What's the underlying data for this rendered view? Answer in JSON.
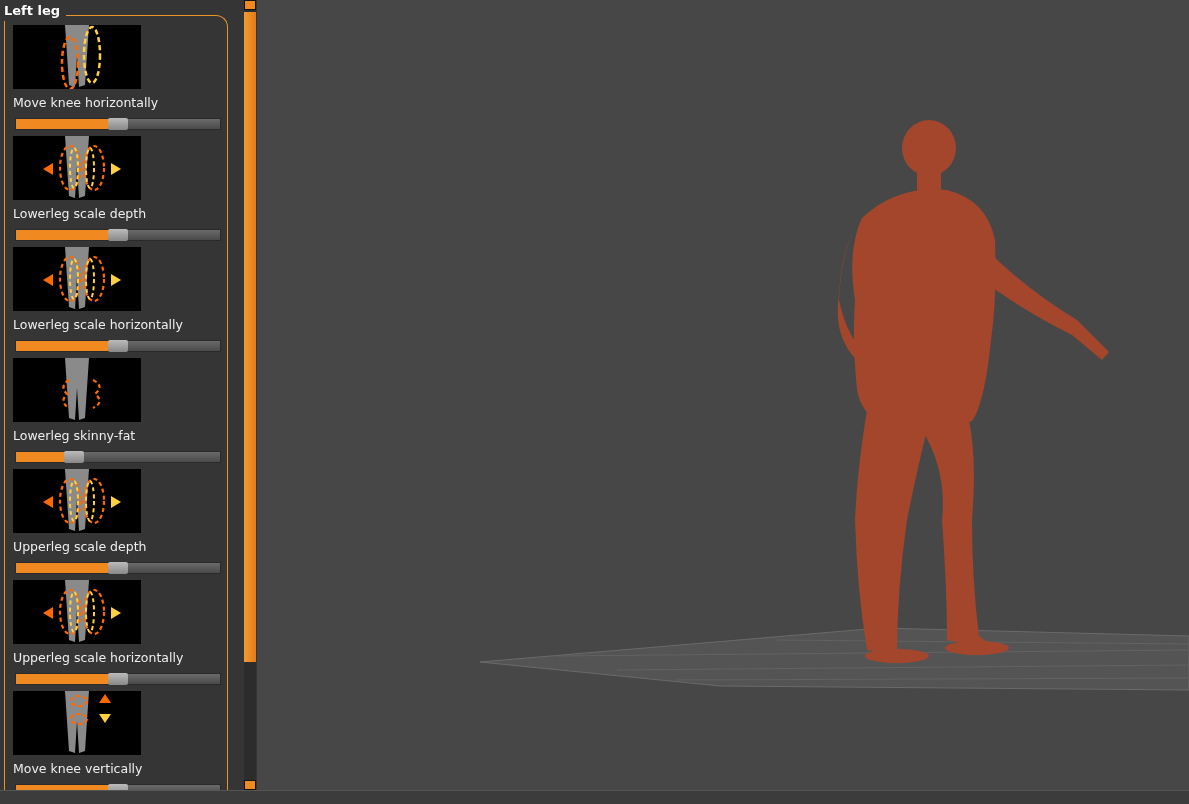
{
  "panel": {
    "title": "Left leg",
    "items": [
      {
        "label": "Move knee horizontally",
        "kind": "ellipse",
        "level": 0.5
      },
      {
        "label": "Lowerleg scale depth",
        "kind": "arrows-lr",
        "level": 0.5
      },
      {
        "label": "Lowerleg scale horizontally",
        "kind": "arrows-lr",
        "level": 0.5
      },
      {
        "label": "Lowerleg skinny-fat",
        "kind": "shape",
        "level": 0.26
      },
      {
        "label": "Upperleg scale depth",
        "kind": "arrows-lr",
        "level": 0.5
      },
      {
        "label": "Upperleg scale horizontally",
        "kind": "arrows-lr",
        "level": 0.5
      },
      {
        "label": "Move knee vertically",
        "kind": "arrows-ud",
        "level": 0.5
      }
    ]
  }
}
